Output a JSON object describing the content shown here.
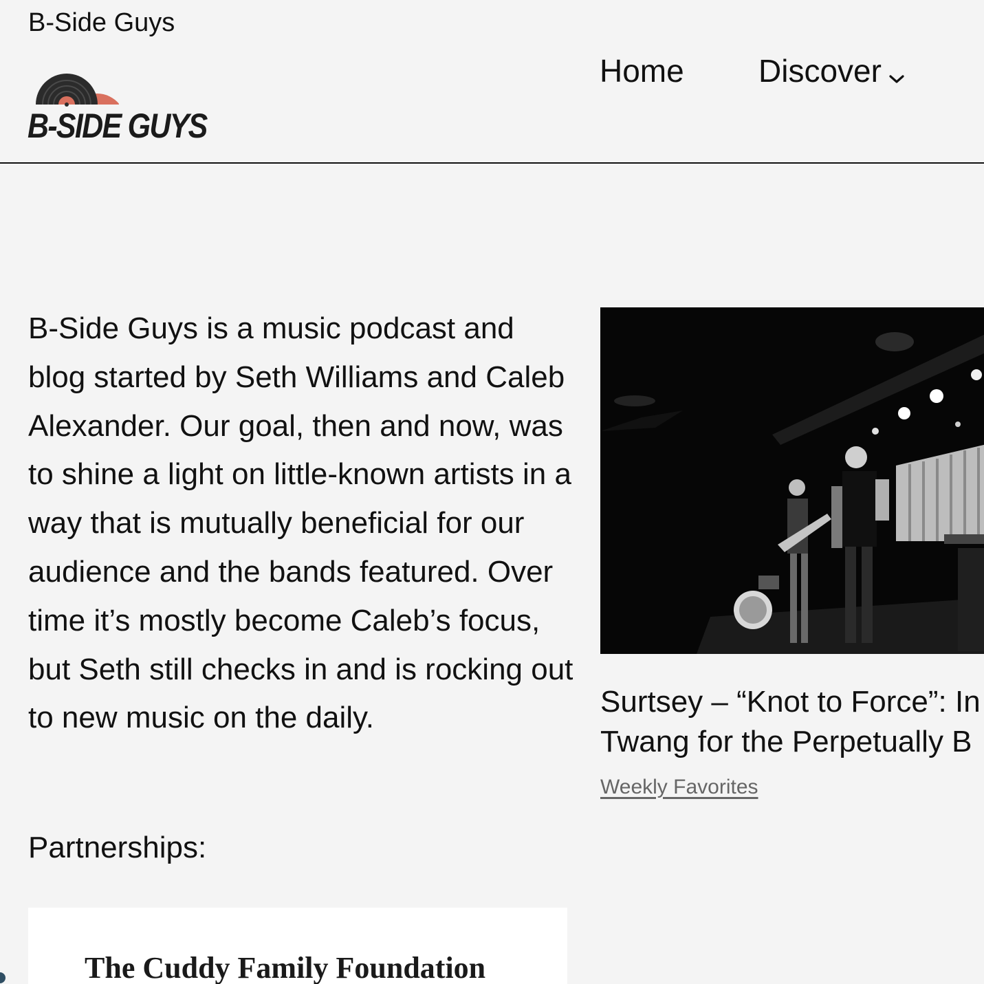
{
  "header": {
    "site_title": "B-Side Guys",
    "logo_text": "B-SIDE GUYS",
    "nav": {
      "home_label": "Home",
      "discover_label": "Discover"
    }
  },
  "main": {
    "intro_text": "B-Side Guys is a music podcast and blog started by Seth Williams and Caleb Alexander. Our goal, then and now, was to shine a light on little-known artists in a way that is mutually beneficial for our audience and the bands featured. Over time it’s mostly become Caleb’s focus, but Seth still checks in and is rocking out to new music on the daily.",
    "partnerships_heading": "Partnerships:",
    "partner_name": "The Cuddy Family Foundation"
  },
  "featured_post": {
    "title_line1": "Surtsey – “Knot to Force”: In",
    "title_line2": "Twang for the Perpetually B",
    "category": "Weekly Favorites"
  },
  "colors": {
    "background": "#f4f4f4",
    "text": "#111111",
    "logo_record_dark": "#2b2b2b",
    "logo_record_accent": "#d9705e",
    "category_link": "#666666"
  }
}
